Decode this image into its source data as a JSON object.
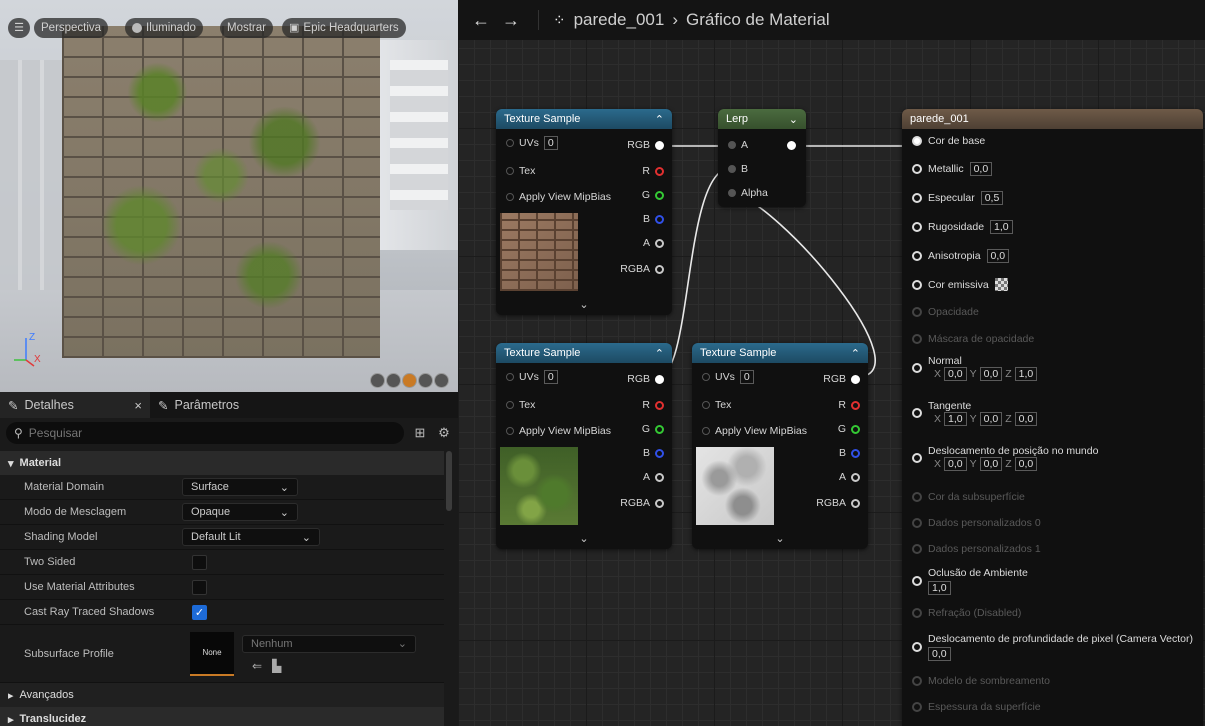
{
  "viewport": {
    "toolbar": {
      "perspective": "Perspectiva",
      "lit": "Iluminado",
      "show": "Mostrar",
      "level": "Epic Headquarters"
    },
    "axis": {
      "z": "Z",
      "x": "X"
    }
  },
  "details": {
    "tabs": [
      {
        "label": "Detalhes",
        "close": "×"
      },
      {
        "label": "Parâmetros"
      }
    ],
    "search_placeholder": "Pesquisar",
    "section_material": "Material",
    "rows": [
      {
        "label": "Material Domain",
        "value": "Surface"
      },
      {
        "label": "Modo de Mesclagem",
        "value": "Opaque"
      },
      {
        "label": "Shading Model",
        "value": "Default Lit"
      },
      {
        "label": "Two Sided",
        "checked": false
      },
      {
        "label": "Use Material Attributes",
        "checked": false
      },
      {
        "label": "Cast Ray Traced Shadows",
        "checked": true
      }
    ],
    "subsurface": {
      "label": "Subsurface Profile",
      "thumb": "None",
      "dropdown": "Nenhum"
    },
    "section_advanced": "Avançados",
    "section_translucency": "Translucidez"
  },
  "graph": {
    "breadcrumb": {
      "asset": "parede_001",
      "separator": "›",
      "page": "Gráfico de Material"
    },
    "texture_nodes": [
      {
        "title": "Texture Sample",
        "uvs_label": "UVs",
        "uvs": "0",
        "tex": "Tex",
        "mip": "Apply View MipBias",
        "out_rgb": "RGB",
        "out_r": "R",
        "out_g": "G",
        "out_b": "B",
        "out_a": "A",
        "out_rgba": "RGBA"
      },
      {
        "title": "Texture Sample",
        "uvs_label": "UVs",
        "uvs": "0",
        "tex": "Tex",
        "mip": "Apply View MipBias",
        "out_rgb": "RGB",
        "out_r": "R",
        "out_g": "G",
        "out_b": "B",
        "out_a": "A",
        "out_rgba": "RGBA"
      },
      {
        "title": "Texture Sample",
        "uvs_label": "UVs",
        "uvs": "0",
        "tex": "Tex",
        "mip": "Apply View MipBias",
        "out_rgb": "RGB",
        "out_r": "R",
        "out_g": "G",
        "out_b": "B",
        "out_a": "A",
        "out_rgba": "RGBA"
      }
    ],
    "lerp": {
      "title": "Lerp",
      "in_a": "A",
      "in_b": "B",
      "in_alpha": "Alpha"
    },
    "result": {
      "title": "parede_001",
      "base_color": "Cor de base",
      "metallic": {
        "label": "Metallic",
        "value": "0,0"
      },
      "specular": {
        "label": "Especular",
        "value": "0,5"
      },
      "roughness": {
        "label": "Rugosidade",
        "value": "1,0"
      },
      "anisotropy": {
        "label": "Anisotropia",
        "value": "0,0"
      },
      "emissive": "Cor emissiva",
      "opacity": "Opacidade",
      "opacity_mask": "Máscara de opacidade",
      "normal": {
        "label": "Normal",
        "x": "0,0",
        "y": "0,0",
        "z": "1,0"
      },
      "tangent": {
        "label": "Tangente",
        "x": "1,0",
        "y": "0,0",
        "z": "0,0"
      },
      "wpo": {
        "label": "Deslocamento de posição no mundo",
        "x": "0,0",
        "y": "0,0",
        "z": "0,0"
      },
      "subsurface_color": "Cor da subsuperfície",
      "custom0": "Dados personalizados 0",
      "custom1": "Dados personalizados 1",
      "ao": {
        "label": "Oclusão de Ambiente",
        "value": "1,0"
      },
      "refraction": "Refração (Disabled)",
      "pdo": {
        "label": "Deslocamento de profundidade de pixel (Camera Vector)",
        "value": "0,0"
      },
      "shading_model": "Modelo de sombreamento",
      "surface_thickness": "Espessura da superfície",
      "x": "X",
      "y": "Y",
      "z": "Z"
    }
  },
  "colors": {
    "accent_blue": "#1d6bd8",
    "accent_orange": "#c97a25"
  }
}
